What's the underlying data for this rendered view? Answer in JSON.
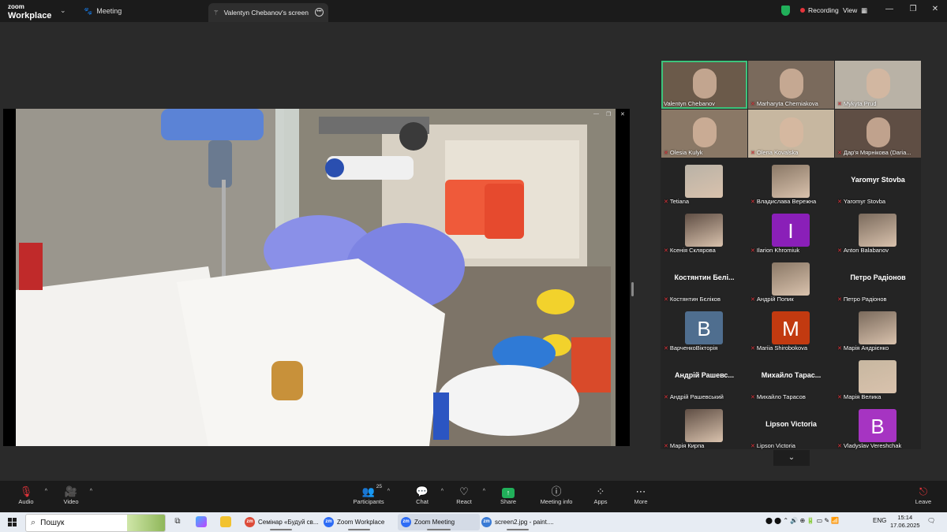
{
  "app": {
    "brand_line1": "zoom",
    "brand_line2": "Workplace",
    "meeting_label": "Meeting",
    "shared_screen_title": "Valentyn Chebanov's screen",
    "recording_label": "Recording",
    "view_label": "View"
  },
  "gallery": {
    "tiles": [
      {
        "name": "Valentyn Chebanov",
        "kind": "video",
        "muted": false,
        "active": true
      },
      {
        "name": "Marharyta Cherniakova",
        "kind": "video",
        "muted": true
      },
      {
        "name": "Mykyta Prud",
        "kind": "video",
        "muted": true
      },
      {
        "name": "Olesia Kulyk",
        "kind": "video",
        "muted": true
      },
      {
        "name": "Olena Kovalska",
        "kind": "video",
        "muted": true
      },
      {
        "name": "Дар'я Мярнікова (Daria...",
        "kind": "video",
        "muted": true
      },
      {
        "name": "Tetiana",
        "kind": "photo",
        "muted": true
      },
      {
        "name": "Владислава Вережна",
        "kind": "photo",
        "muted": true
      },
      {
        "name": "Yaromyr Stovba",
        "kind": "text",
        "display": "Yaromyr Stovba",
        "muted": true
      },
      {
        "name": "Ксенія Склярова",
        "kind": "photo",
        "muted": true
      },
      {
        "name": "Ilarion Khromiuk",
        "kind": "letter",
        "letter": "I",
        "color": "#8a1fb8",
        "muted": true
      },
      {
        "name": "Anton Balabanov",
        "kind": "photo",
        "muted": true
      },
      {
        "name": "Костянтин Бєліков",
        "kind": "text",
        "display": "Костянтин Белі...",
        "muted": true
      },
      {
        "name": "Андрій Попик",
        "kind": "photo",
        "muted": true
      },
      {
        "name": "Петро Радіонов",
        "kind": "text",
        "display": "Петро Радіонов",
        "muted": true
      },
      {
        "name": "ВарченкоВікторія",
        "kind": "letter",
        "letter": "B",
        "color": "#4f6e8f",
        "muted": true
      },
      {
        "name": "Mariia Shirobokova",
        "kind": "letter",
        "letter": "M",
        "color": "#c23a10",
        "muted": true
      },
      {
        "name": "Марія Андрієнко",
        "kind": "photo",
        "muted": true
      },
      {
        "name": "Андрій Рашевський",
        "kind": "text",
        "display": "Андрій Рашевс...",
        "muted": true
      },
      {
        "name": "Михайло Тарасов",
        "kind": "text",
        "display": "Михайло Тарас...",
        "muted": true
      },
      {
        "name": "Марія Велика",
        "kind": "photo",
        "muted": true
      },
      {
        "name": "Марія Кирпа",
        "kind": "photo",
        "muted": true
      },
      {
        "name": "Lipson Victoria",
        "kind": "text",
        "display": "Lipson Victoria",
        "muted": true
      },
      {
        "name": "Vladyslav Vereshchak",
        "kind": "letter",
        "letter": "B",
        "color": "#a634c2",
        "muted": true
      }
    ]
  },
  "toolbar": {
    "audio": "Audio",
    "video": "Video",
    "participants": "Participants",
    "participants_count": "25",
    "chat": "Chat",
    "react": "React",
    "share": "Share",
    "meeting_info": "Meeting info",
    "apps": "Apps",
    "more": "More",
    "leave": "Leave"
  },
  "taskbar": {
    "search_text": "Пошук",
    "tasks": [
      {
        "label": "Семінар «Будуй св...",
        "icon_color": "#dd4b39"
      },
      {
        "label": "Zoom Workplace",
        "icon_color": "#2d6cf5"
      },
      {
        "label": "Zoom Meeting",
        "icon_color": "#2d6cf5"
      },
      {
        "label": "screen2.jpg - paint....",
        "icon_color": "#3a7bd5"
      }
    ],
    "lang": "ENG",
    "time": "15:14",
    "date": "17.06.2025"
  },
  "colors": {
    "accent_green": "#21b05a",
    "recording_red": "#e5343b",
    "active_speaker": "#3cc47c"
  }
}
